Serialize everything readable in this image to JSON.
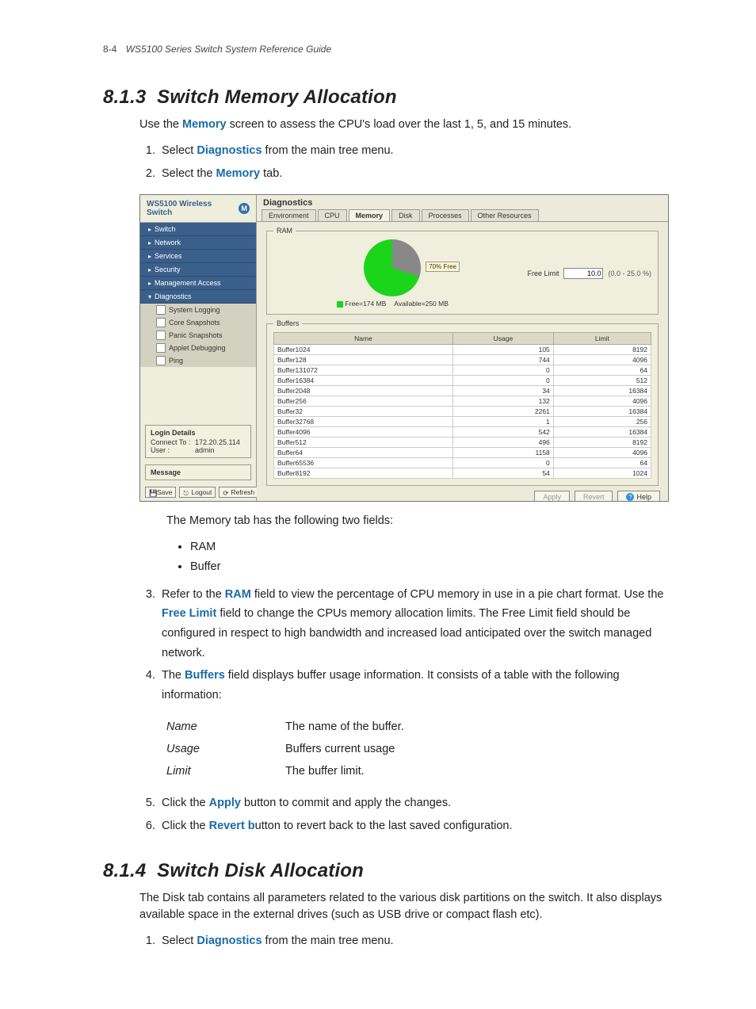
{
  "header": {
    "page_num": "8-4",
    "doc_title": "WS5100 Series Switch System Reference Guide"
  },
  "section813": {
    "number": "8.1.3",
    "title": "Switch Memory Allocation",
    "intro_pre": "Use the ",
    "intro_kw": "Memory",
    "intro_post": " screen to assess the CPU's load over the last 1, 5, and 15 minutes.",
    "step1_pre": "Select ",
    "step1_kw": "Diagnostics",
    "step1_post": " from the main tree menu.",
    "step2_pre": "Select the ",
    "step2_kw": "Memory",
    "step2_post": " tab.",
    "after_shot": "The Memory tab has the following two fields:",
    "bullet1": "RAM",
    "bullet2": "Buffer",
    "step3_pre": "Refer to the ",
    "step3_kw1": "RAM",
    "step3_mid": " field to view the percentage of CPU memory in use in a pie chart format. Use the ",
    "step3_kw2": "Free Limit",
    "step3_post": " field to change the CPUs memory allocation limits. The Free Limit field should be configured in respect to high bandwidth and increased load anticipated over the switch managed network.",
    "step4_pre": "The ",
    "step4_kw": "Buffers",
    "step4_post": " field displays buffer usage information. It consists of a table with the following information:",
    "def_name_t": "Name",
    "def_name_d": "The name of the buffer.",
    "def_usage_t": "Usage",
    "def_usage_d": "Buffers current usage",
    "def_limit_t": "Limit",
    "def_limit_d": "The buffer limit.",
    "step5_pre": "Click the ",
    "step5_kw": "Apply",
    "step5_post": " button to commit and apply the changes.",
    "step6_pre": "Click the ",
    "step6_kw": "Revert b",
    "step6_post": "utton to revert back to the last saved configuration."
  },
  "section814": {
    "number": "8.1.4",
    "title": "Switch Disk Allocation",
    "intro": "The Disk tab contains all parameters related to the various disk partitions on the switch. It also displays available space in the external drives (such as USB drive or compact flash etc).",
    "step1_pre": "Select ",
    "step1_kw": "Diagnostics",
    "step1_post": " from the main tree menu."
  },
  "shot": {
    "product": "WS5100 Wireless Switch",
    "nav": {
      "switch": "Switch",
      "network": "Network",
      "services": "Services",
      "security": "Security",
      "mgmt": "Management Access",
      "diag": "Diagnostics"
    },
    "subnav": {
      "syslog": "System Logging",
      "core": "Core Snapshots",
      "panic": "Panic Snapshots",
      "applet": "Applet Debugging",
      "ping": "Ping"
    },
    "login": {
      "title": "Login Details",
      "connect_lbl": "Connect To :",
      "connect_val": "172.20.25.114",
      "user_lbl": "User :",
      "user_val": "admin"
    },
    "message_title": "Message",
    "sb_btn_save": "Save",
    "sb_btn_logout": "Logout",
    "sb_btn_refresh": "Refresh",
    "main_title": "Diagnostics",
    "tabs": {
      "env": "Environment",
      "cpu": "CPU",
      "mem": "Memory",
      "disk": "Disk",
      "proc": "Processes",
      "other": "Other Resources"
    },
    "ram": {
      "legend": "RAM",
      "callout": "70% Free",
      "free_text": "Free=174 MB",
      "avail_text": "Available=250 MB",
      "free_limit_lbl": "Free Limit",
      "free_limit_val": "10.0",
      "free_limit_range": "(0.0 - 25.0 %)"
    },
    "buffers": {
      "legend": "Buffers",
      "col_name": "Name",
      "col_usage": "Usage",
      "col_limit": "Limit",
      "rows": [
        {
          "n": "Buffer1024",
          "u": "105",
          "l": "8192"
        },
        {
          "n": "Buffer128",
          "u": "744",
          "l": "4096"
        },
        {
          "n": "Buffer131072",
          "u": "0",
          "l": "64"
        },
        {
          "n": "Buffer16384",
          "u": "0",
          "l": "512"
        },
        {
          "n": "Buffer2048",
          "u": "34",
          "l": "16384"
        },
        {
          "n": "Buffer256",
          "u": "132",
          "l": "4096"
        },
        {
          "n": "Buffer32",
          "u": "2261",
          "l": "16384"
        },
        {
          "n": "Buffer32768",
          "u": "1",
          "l": "256"
        },
        {
          "n": "Buffer4096",
          "u": "542",
          "l": "16384"
        },
        {
          "n": "Buffer512",
          "u": "496",
          "l": "8192"
        },
        {
          "n": "Buffer64",
          "u": "1158",
          "l": "4096"
        },
        {
          "n": "Buffer65536",
          "u": "0",
          "l": "64"
        },
        {
          "n": "Buffer8192",
          "u": "54",
          "l": "1024"
        }
      ]
    },
    "btn_apply": "Apply",
    "btn_revert": "Revert",
    "btn_help": "Help"
  },
  "chart_data": {
    "type": "pie",
    "title": "RAM",
    "series": [
      {
        "name": "Free",
        "value": 174,
        "percent": 70,
        "color": "#1bd51b"
      },
      {
        "name": "Used",
        "value": 76,
        "percent": 30,
        "color": "#888888"
      }
    ],
    "total_label": "Available=250 MB",
    "free_label": "Free=174 MB",
    "annotation": "70% Free"
  }
}
